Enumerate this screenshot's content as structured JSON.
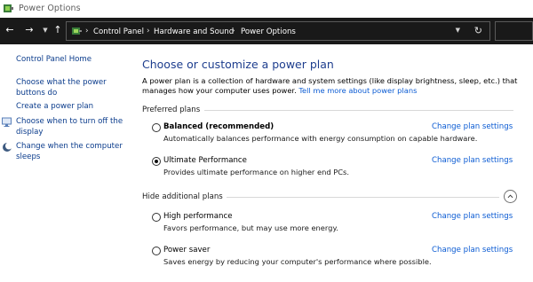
{
  "window": {
    "title": "Power Options",
    "app_icon": "power-options-icon"
  },
  "address_bar": {
    "crumbs": [
      "Control Panel",
      "Hardware and Sound",
      "Power Options"
    ],
    "icon": "control-panel-icon"
  },
  "sidebar": {
    "home": "Control Panel Home",
    "links": [
      {
        "label": "Choose what the power buttons do",
        "icon": null
      },
      {
        "label": "Create a power plan",
        "icon": null
      },
      {
        "label": "Choose when to turn off the display",
        "icon": "display-shield-icon"
      },
      {
        "label": "Change when the computer sleeps",
        "icon": "moon-icon"
      }
    ]
  },
  "main": {
    "heading": "Choose or customize a power plan",
    "intro": "A power plan is a collection of hardware and system settings (like display brightness, sleep, etc.) that manages how your computer uses power.",
    "intro_link": "Tell me more about power plans",
    "preferred_label": "Preferred plans",
    "additional_label": "Hide additional plans",
    "change_link": "Change plan settings",
    "plans": [
      {
        "name": "Balanced (recommended)",
        "desc": "Automatically balances performance with energy consumption on capable hardware.",
        "selected": false,
        "bold": true
      },
      {
        "name": "Ultimate Performance",
        "desc": "Provides ultimate performance on higher end PCs.",
        "selected": true,
        "bold": false
      },
      {
        "name": "High performance",
        "desc": "Favors performance, but may use more energy.",
        "selected": false,
        "bold": false
      },
      {
        "name": "Power saver",
        "desc": "Saves energy by reducing your computer's performance where possible.",
        "selected": false,
        "bold": false
      }
    ]
  }
}
